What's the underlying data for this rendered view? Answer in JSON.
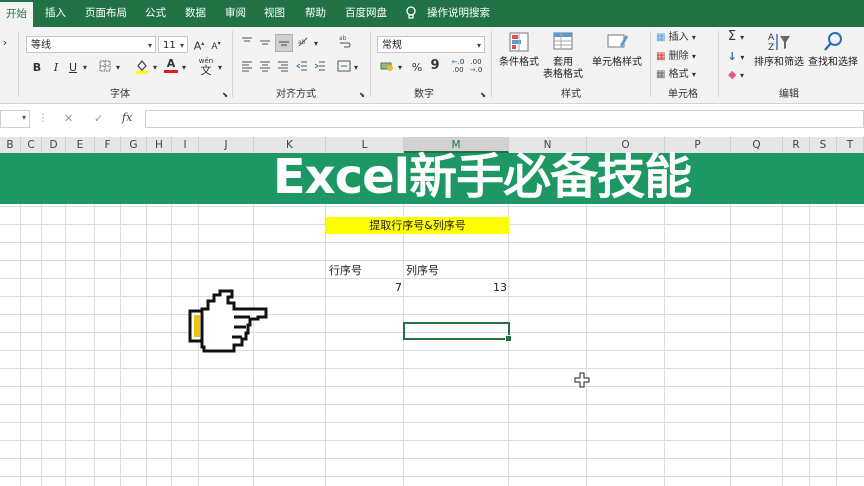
{
  "tabs": [
    "开始",
    "插入",
    "页面布局",
    "公式",
    "数据",
    "审阅",
    "视图",
    "帮助",
    "百度网盘",
    "操作说明搜索"
  ],
  "ribbon": {
    "font_name": "等线",
    "font_size": "11",
    "number_format": "常规",
    "groups": {
      "font": "字体",
      "alignment": "对齐方式",
      "number": "数字",
      "styles": "样式",
      "cells": "单元格",
      "editing": "编辑"
    },
    "buttons": {
      "conditional_format": "条件格式",
      "table_format_l1": "套用",
      "table_format_l2": "表格格式",
      "cell_styles": "单元格样式",
      "insert": "插入",
      "delete": "删除",
      "format": "格式",
      "sort_filter": "排序和筛选",
      "find_select": "查找和选择"
    },
    "bold": "B",
    "italic": "I",
    "underline": "U",
    "text_color_glyph": "A",
    "wen_glyph": "文",
    "percent": "%",
    "comma": "9"
  },
  "formula_bar": {
    "fx": "fx",
    "cancel": "✕",
    "enter": "✓",
    "value": ""
  },
  "columns": [
    "B",
    "C",
    "D",
    "E",
    "F",
    "G",
    "H",
    "I",
    "J",
    "K",
    "L",
    "M",
    "N",
    "O",
    "P",
    "Q",
    "R",
    "S",
    "T"
  ],
  "selected_column": "M",
  "banner": {
    "title": "Excel新手必备技能",
    "bg_color": "#1d9865"
  },
  "sheet": {
    "header_cell": "提取行序号&列序号",
    "header_highlight": "#ffff00",
    "row_label": "行序号",
    "col_label": "列序号",
    "row_value": "7",
    "col_value": "13"
  },
  "accent": "#217346"
}
